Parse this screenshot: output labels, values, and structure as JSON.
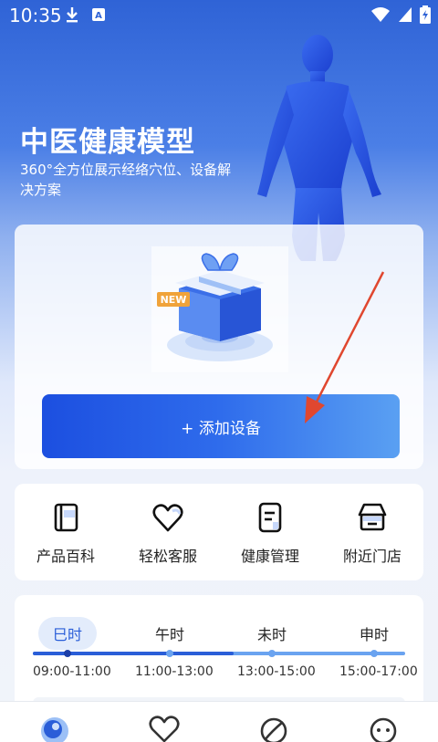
{
  "status_bar": {
    "time": "10:35",
    "icons": [
      "download-icon",
      "font-badge-icon",
      "wifi-icon",
      "cellular-icon",
      "battery-charging-icon"
    ]
  },
  "hero": {
    "title": "中医健康模型",
    "subtitle": "360°全方位展示经络穴位、设备解决方案"
  },
  "device_card": {
    "gift_badge": "NEW",
    "add_button_label": "+ 添加设备"
  },
  "quick_actions": [
    {
      "label": "产品百科",
      "icon": "book-icon"
    },
    {
      "label": "轻松客服",
      "icon": "heart-icon"
    },
    {
      "label": "健康管理",
      "icon": "document-icon"
    },
    {
      "label": "附近门店",
      "icon": "store-icon"
    }
  ],
  "meridian_times": {
    "periods": [
      {
        "name": "巳时",
        "range": "09:00-11:00",
        "active": true
      },
      {
        "name": "午时",
        "range": "11:00-13:00",
        "active": false
      },
      {
        "name": "未时",
        "range": "13:00-15:00",
        "active": false
      },
      {
        "name": "申时",
        "range": "15:00-17:00",
        "active": false
      }
    ]
  },
  "bottom_nav": [
    {
      "icon": "home-globe-icon",
      "active": true
    },
    {
      "icon": "heart-icon",
      "active": false
    },
    {
      "icon": "leaf-icon",
      "active": false
    },
    {
      "icon": "profile-face-icon",
      "active": false
    }
  ],
  "colors": {
    "brand_blue": "#2a5ed8",
    "button_gradient_start": "#1c4fe0",
    "button_gradient_end": "#5aa0f2",
    "arrow_red": "#e0472f"
  }
}
